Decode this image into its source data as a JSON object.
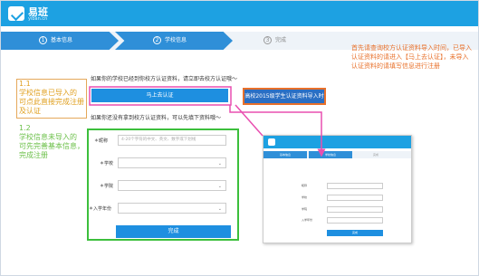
{
  "header": {
    "logo_name": "易班",
    "logo_sub": "yiban.cn"
  },
  "steps": [
    {
      "num": "1",
      "label": "基本信息"
    },
    {
      "num": "2",
      "label": "学校信息"
    },
    {
      "num": "3",
      "label": "完成"
    }
  ],
  "section1": {
    "question": "如果你的学校已经到你校方认证资料，请立即去校方认证哦～",
    "auth_button": "马上去认证",
    "import_button": "高校2015级学生认证资料导入时间"
  },
  "note1": {
    "text": "1.1\n学校信息已导入的\n可点此直接完成注册及认证"
  },
  "section2": {
    "question": "如果你还没有拿到校方认证资料，可以先填下资料哦～",
    "fields": [
      {
        "label": "＊昵称",
        "placeholder": "4-20个字符的中文、英文、数字或下划线"
      },
      {
        "label": "＊学校",
        "value": ""
      },
      {
        "label": "＊学院",
        "value": ""
      },
      {
        "label": "＊入学年份",
        "value": ""
      }
    ],
    "finish_button": "完成"
  },
  "note2": {
    "text": "1.2\n学校信息未导入的\n可先完善基本信息，\n完成注册"
  },
  "callout": {
    "text": "首先请查询校方认证资料导入时间，已导入认证资料的请进入【马上去认证】，未导入认证资料的请填写信息进行注册"
  },
  "thumb": {
    "steps": [
      "基本信息",
      "学校信息",
      "完成"
    ],
    "labels": [
      "昵称",
      "学校",
      "学院",
      "入学年份"
    ],
    "button": "完成"
  },
  "colors": {
    "brand": "#1da1e2",
    "accent": "#e8702a",
    "green": "#3cbf3c",
    "pink": "#e94fb0"
  }
}
